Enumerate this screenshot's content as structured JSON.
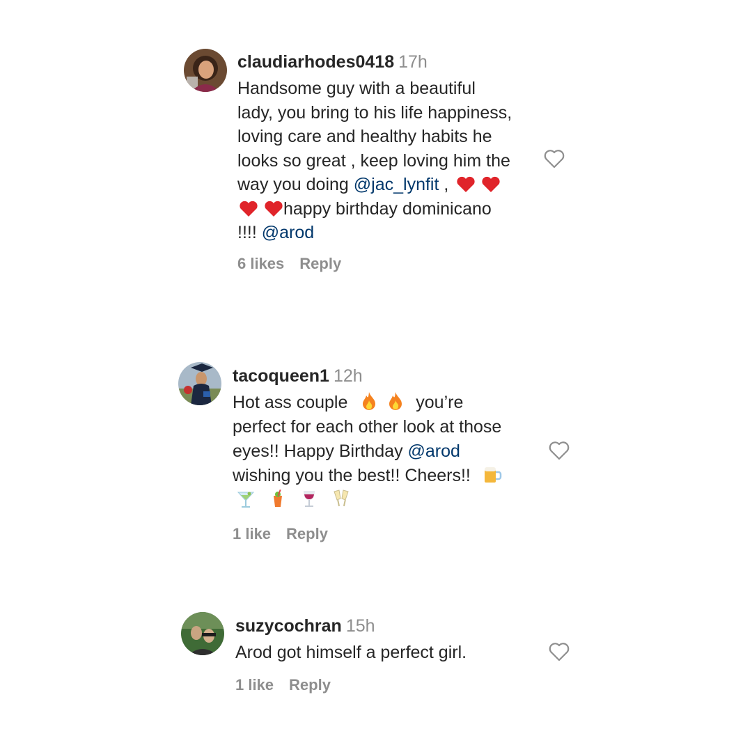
{
  "comments": [
    {
      "username": "claudiarhodes0418",
      "time": "17h",
      "lines": [
        [
          "Handsome guy with a beautiful"
        ],
        [
          "lady, you bring to his life happiness,"
        ],
        [
          "loving care and healthy habits he"
        ],
        [
          "looks so great , keep loving him the"
        ],
        [
          "way you doing ",
          "@jac_lynfit",
          " ,"
        ],
        [
          "happy birthday dominicano"
        ],
        [
          "!!!! ",
          "@arod"
        ]
      ],
      "likes": "6 likes",
      "reply": "Reply"
    },
    {
      "username": "tacoqueen1",
      "time": "12h",
      "lines": [
        [
          "Hot ass couple",
          "you’re"
        ],
        [
          "perfect for each other look at those"
        ],
        [
          "eyes!! Happy Birthday ",
          "@arod"
        ],
        [
          "wishing you the best!! Cheers!!"
        ]
      ],
      "likes": "1 like",
      "reply": "Reply"
    },
    {
      "username": "suzycochran",
      "time": "15h",
      "lines": [
        [
          "Arod got himself a perfect girl."
        ]
      ],
      "likes": "1 like",
      "reply": "Reply"
    }
  ],
  "emoji": {
    "heart_color": "#e0242a",
    "fire_outer": "#f5821f",
    "fire_inner": "#fdd835"
  },
  "colors": {
    "text": "#262626",
    "muted": "#8e8e8e",
    "mention": "#00376b"
  }
}
